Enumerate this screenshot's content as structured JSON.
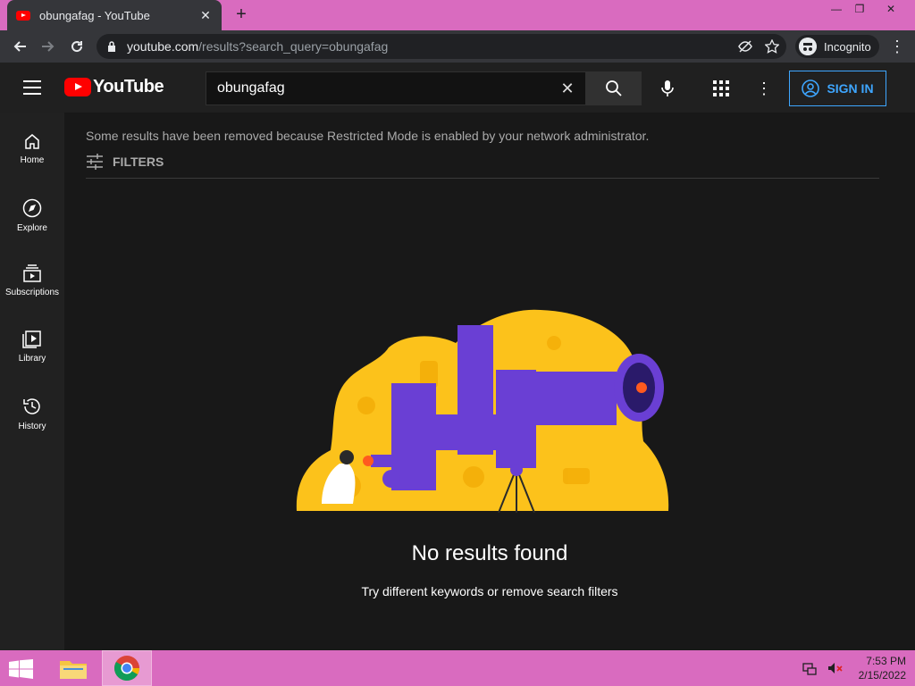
{
  "browser": {
    "tab_title": "obungafag - YouTube",
    "new_tab": "+",
    "tab_close": "✕",
    "win_min": "—",
    "win_restore": "❐",
    "win_close": "✕",
    "url_host": "youtube.com",
    "url_path": "/results?search_query=obungafag",
    "incognito_label": "Incognito"
  },
  "youtube": {
    "logo_text": "YouTube",
    "search_value": "obungafag",
    "sign_in": "SIGN IN"
  },
  "sidebar": {
    "items": [
      {
        "label": "Home",
        "icon": "home-icon"
      },
      {
        "label": "Explore",
        "icon": "compass-icon"
      },
      {
        "label": "Subscriptions",
        "icon": "subscriptions-icon"
      },
      {
        "label": "Library",
        "icon": "library-icon"
      },
      {
        "label": "History",
        "icon": "history-icon"
      }
    ]
  },
  "main": {
    "restricted_notice": "Some results have been removed because Restricted Mode is enabled by your network administrator.",
    "filters_label": "FILTERS",
    "no_results_title": "No results found",
    "no_results_hint": "Try different keywords or remove search filters"
  },
  "colors": {
    "accent_blue": "#3ea6ff",
    "brand_red": "#ff0000",
    "illustration_yellow": "#fcc21b",
    "illustration_purple": "#6a3fd4"
  },
  "taskbar": {
    "time": "7:53 PM",
    "date": "2/15/2022"
  }
}
